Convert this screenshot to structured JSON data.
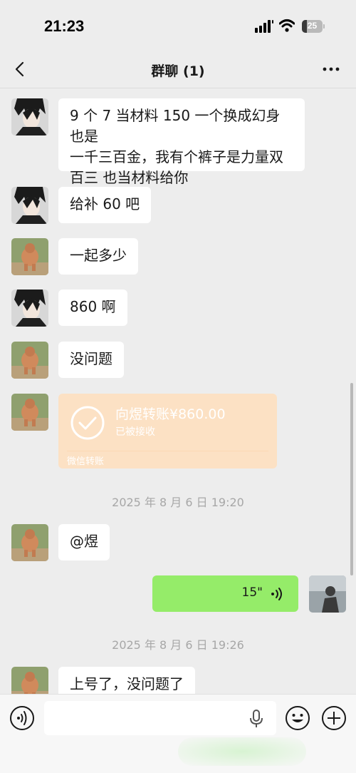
{
  "status_bar": {
    "time": "21:23",
    "battery_percent": "25",
    "battery_level": 0.25
  },
  "nav": {
    "title": "群聊 (1)",
    "back_icon": "chevron-left-icon",
    "more_icon": "more-dots-icon"
  },
  "messages": [
    {
      "sender": "avatar-dark-hair",
      "text": "9 个 7 当材料 150 一个换成幻身也是\n一千三百金，我有个裤子是力量双\n百三 也当材料给你"
    },
    {
      "sender": "avatar-dark-hair",
      "text": "给补 60 吧"
    },
    {
      "sender": "avatar-stocky",
      "text": "一起多少"
    },
    {
      "sender": "avatar-dark-hair",
      "text": "860 啊"
    },
    {
      "sender": "avatar-stocky",
      "text": "没问题"
    }
  ],
  "transfer": {
    "title": "向煜转账¥860.00",
    "status": "已被接收",
    "footer": "微信转账",
    "color": "#fce1c4"
  },
  "timestamps": [
    "2025 年 8 月 6 日 19:20",
    "2025 年 8 月 6 日 19:26"
  ],
  "mention_message": {
    "text": "@煜"
  },
  "voice_message": {
    "duration": "15\"",
    "icon": "voice-wave-icon"
  },
  "last_message": {
    "text": "上号了，没问题了"
  },
  "input_bar": {
    "placeholder": "",
    "voice_icon": "voice-mode-icon",
    "mic_icon": "microphone-icon",
    "emoji_icon": "emoji-icon",
    "plus_icon": "plus-icon"
  },
  "colors": {
    "self_bubble": "#95ec69",
    "other_bubble": "#ffffff",
    "background": "#ededed"
  }
}
